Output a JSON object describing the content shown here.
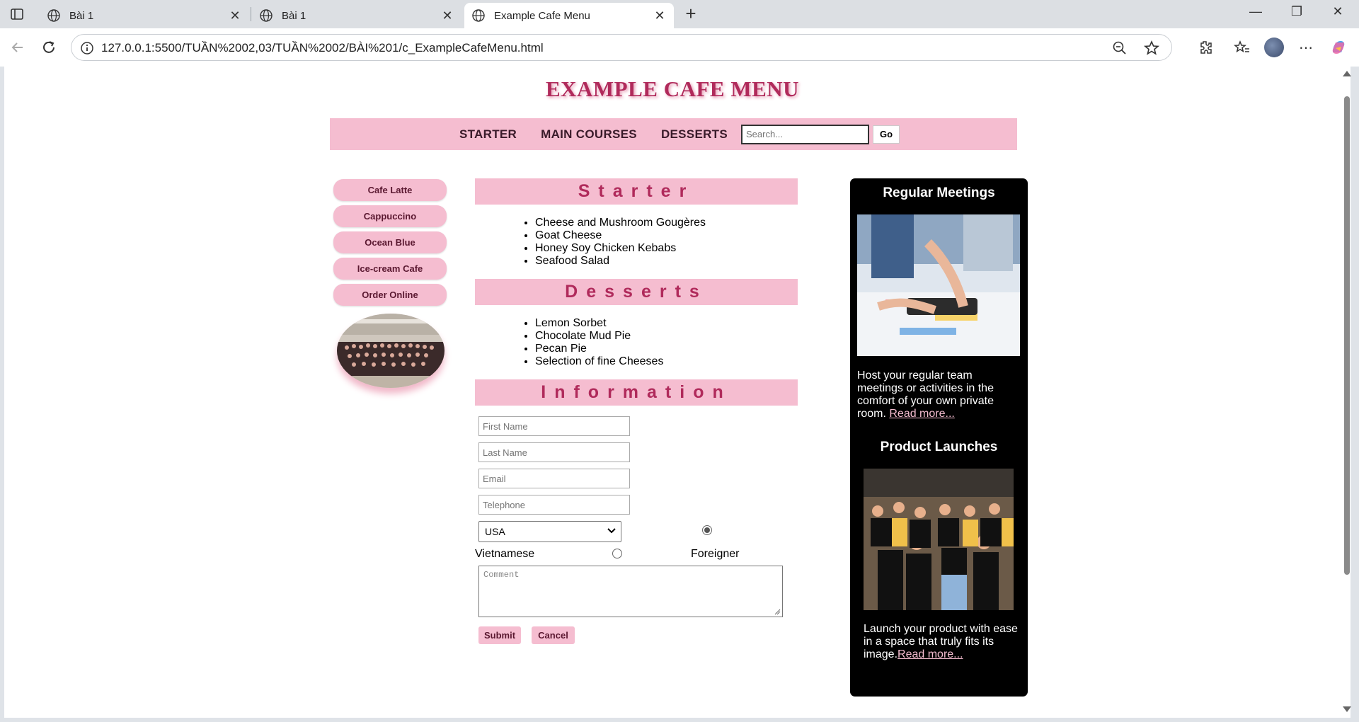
{
  "browser": {
    "tabs": [
      {
        "title": "Bài 1"
      },
      {
        "title": "Bài 1"
      },
      {
        "title": "Example Cafe Menu"
      }
    ],
    "url": "127.0.0.1:5500/TUẦN%2002,03/TUẦN%2002/BÀI%201/c_ExampleCafeMenu.html"
  },
  "page": {
    "title": "EXAMPLE CAFE MENU",
    "nav": {
      "links": [
        "STARTER",
        "MAIN COURSES",
        "DESSERTS"
      ],
      "search_placeholder": "Search...",
      "go_label": "Go"
    },
    "sidebar": {
      "items": [
        "Cafe Latte",
        "Cappuccino",
        "Ocean Blue",
        "Ice-cream Cafe",
        "Order Online"
      ]
    },
    "sections": {
      "starter": {
        "heading": "Starter",
        "items": [
          "Cheese and Mushroom Gougères",
          "Goat Cheese",
          "Honey Soy Chicken Kebabs",
          "Seafood Salad"
        ]
      },
      "desserts": {
        "heading": "Desserts",
        "items": [
          "Lemon Sorbet",
          "Chocolate Mud Pie",
          "Pecan Pie",
          "Selection of fine Cheeses"
        ]
      },
      "information": {
        "heading": "Information",
        "fields": {
          "first_name": "First Name",
          "last_name": "Last Name",
          "email": "Email",
          "telephone": "Telephone"
        },
        "country": "USA",
        "radio_vietnamese": "Vietnamese",
        "radio_foreigner": "Foreigner",
        "comment_placeholder": "Comment",
        "submit_label": "Submit",
        "cancel_label": "Cancel"
      }
    },
    "right": {
      "meetings_title": "Regular Meetings",
      "meetings_text": "Host your regular team meetings or activities in the comfort of your own private room.",
      "meetings_link": "Read more...",
      "launches_title": "Product Launches",
      "launches_text": "Launch your product with ease in a space that truly fits its image.",
      "launches_link": "Read more..."
    }
  },
  "colors": {
    "accent_pink": "#f5bdd0",
    "title_magenta": "#b02a5b"
  }
}
